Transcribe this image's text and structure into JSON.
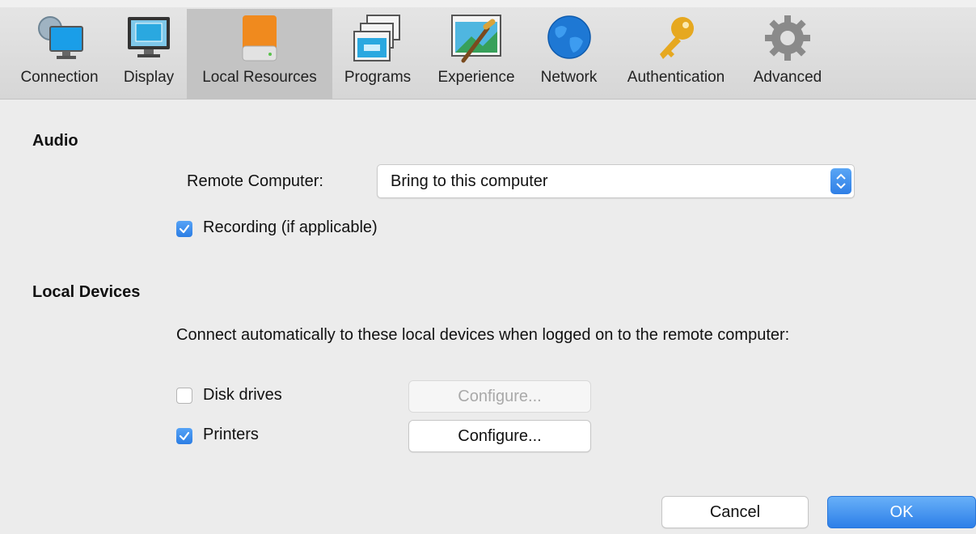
{
  "toolbar": {
    "tabs": [
      {
        "label": "Connection",
        "icon": "connection-icon",
        "selected": false
      },
      {
        "label": "Display",
        "icon": "display-icon",
        "selected": false
      },
      {
        "label": "Local Resources",
        "icon": "local-resources-icon",
        "selected": true
      },
      {
        "label": "Programs",
        "icon": "programs-icon",
        "selected": false
      },
      {
        "label": "Experience",
        "icon": "experience-icon",
        "selected": false
      },
      {
        "label": "Network",
        "icon": "network-icon",
        "selected": false
      },
      {
        "label": "Authentication",
        "icon": "authentication-icon",
        "selected": false
      },
      {
        "label": "Advanced",
        "icon": "advanced-icon",
        "selected": false
      }
    ]
  },
  "audio": {
    "title": "Audio",
    "remote_computer_label": "Remote Computer:",
    "remote_computer_value": "Bring to this computer",
    "recording_label": "Recording (if applicable)",
    "recording_checked": true
  },
  "local_devices": {
    "title": "Local Devices",
    "description": "Connect automatically to these local devices when logged on to the remote computer:",
    "disk_drives_label": "Disk drives",
    "disk_drives_checked": false,
    "disk_drives_configure": "Configure...",
    "printers_label": "Printers",
    "printers_checked": true,
    "printers_configure": "Configure..."
  },
  "footer": {
    "cancel_label": "Cancel",
    "ok_label": "OK"
  },
  "colors": {
    "accent": "#2f7fe6",
    "selected_tab": "#c3c3c3",
    "background": "#ececec"
  }
}
